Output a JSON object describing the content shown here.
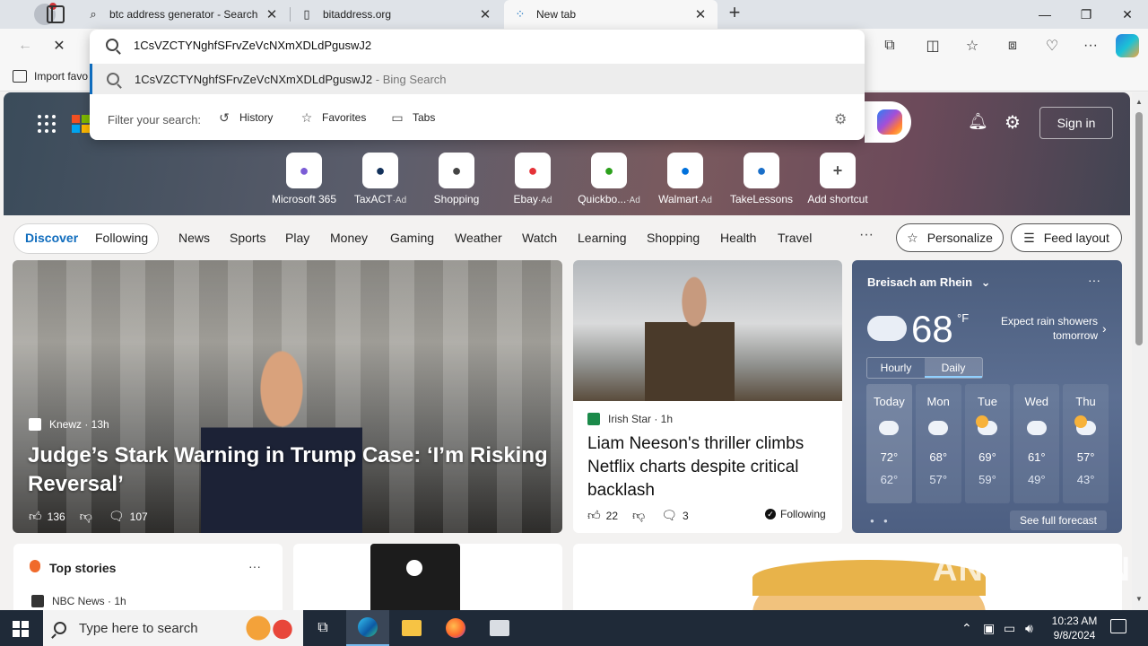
{
  "browser": {
    "tabs": [
      {
        "title": "btc address generator - Search",
        "icon": "search-icon"
      },
      {
        "title": "bitaddress.org",
        "icon": "page-icon"
      },
      {
        "title": "New tab",
        "icon": "loading-icon"
      }
    ],
    "address": {
      "value": "1CsVZCTYNghfSFrvZeVcNXmXDLdPguswJ2",
      "suggestion": "1CsVZCTYNghfSFrvZeVcNXmXDLdPguswJ2",
      "suggestion_sub": "- Bing Search",
      "filter_label": "Filter your search:",
      "filters": [
        "History",
        "Favorites",
        "Tabs"
      ]
    },
    "favorites_bar": {
      "import_label": "Import favo"
    }
  },
  "newtab": {
    "sign_in": "Sign in",
    "shortcuts": [
      {
        "label": "Microsoft 365",
        "ad": "",
        "color": "#7b5cd6"
      },
      {
        "label": "TaxACT",
        "ad": "·Ad",
        "color": "#12315a"
      },
      {
        "label": "Shopping",
        "ad": "",
        "color": "#444444"
      },
      {
        "label": "Ebay",
        "ad": "·Ad",
        "color": "#e53238"
      },
      {
        "label": "Quickbo...",
        "ad": "·Ad",
        "color": "#2ca01c"
      },
      {
        "label": "Walmart",
        "ad": "·Ad",
        "color": "#0071dc"
      },
      {
        "label": "TakeLessons",
        "ad": "",
        "color": "#1a6fc9"
      },
      {
        "label": "Add shortcut",
        "ad": "",
        "color": "#555555"
      }
    ],
    "nav": {
      "discover": "Discover",
      "following": "Following",
      "items": [
        "News",
        "Sports",
        "Play",
        "Money",
        "Gaming",
        "Weather",
        "Watch",
        "Learning",
        "Shopping",
        "Health",
        "Travel"
      ],
      "more": "···",
      "personalize": "Personalize",
      "feed_layout": "Feed layout"
    },
    "main_story": {
      "source": "Knewz · 13h",
      "title": "Judge’s Stark Warning in Trump Case: ‘I’m Risking Reversal’",
      "likes": "136",
      "comments": "107"
    },
    "mid_story": {
      "source": "Irish Star · 1h",
      "title": "Liam Neeson's thriller climbs Netflix charts despite critical backlash",
      "likes": "22",
      "comments": "3",
      "following": "Following"
    },
    "weather": {
      "location": "Breisach am Rhein",
      "temp": "68",
      "unit": "°F",
      "desc": "Expect rain showers tomorrow",
      "tab_hourly": "Hourly",
      "tab_daily": "Daily",
      "days": [
        {
          "day": "Today",
          "hi": "72°",
          "lo": "62°",
          "sun": false
        },
        {
          "day": "Mon",
          "hi": "68°",
          "lo": "57°",
          "sun": false
        },
        {
          "day": "Tue",
          "hi": "69°",
          "lo": "59°",
          "sun": true
        },
        {
          "day": "Wed",
          "hi": "61°",
          "lo": "49°",
          "sun": false
        },
        {
          "day": "Thu",
          "hi": "57°",
          "lo": "43°",
          "sun": true
        }
      ],
      "forecast_link": "See full forecast"
    },
    "top_stories": {
      "title": "Top stories",
      "source": "NBC News · 1h"
    }
  },
  "watermark": "ANY ▷ RUN",
  "taskbar": {
    "search_placeholder": "Type here to search",
    "time": "10:23 AM",
    "date": "9/8/2024"
  }
}
